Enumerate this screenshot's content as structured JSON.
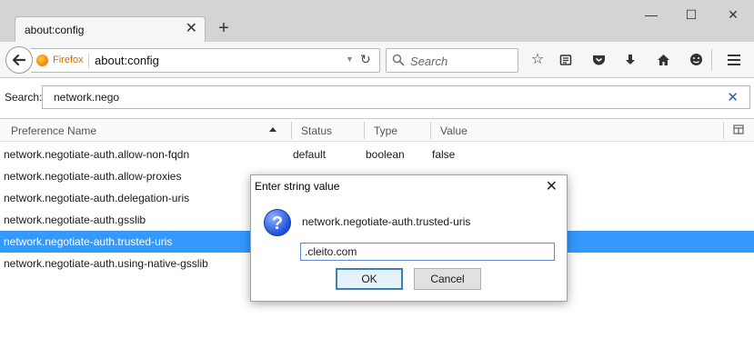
{
  "tab": {
    "title": "about:config",
    "close": "✕",
    "new_tab": "+"
  },
  "window": {
    "minimize": "—",
    "maximize": "☐",
    "close": "✕"
  },
  "navbar": {
    "identity_label": "Firefox",
    "url": "about:config",
    "search_placeholder": "Search"
  },
  "filter": {
    "label": "Search:",
    "value": "network.nego"
  },
  "columns": {
    "name": "Preference Name",
    "status": "Status",
    "type": "Type",
    "value": "Value"
  },
  "rows": [
    {
      "name": "network.negotiate-auth.allow-non-fqdn",
      "status": "default",
      "type": "boolean",
      "value": "false",
      "selected": false
    },
    {
      "name": "network.negotiate-auth.allow-proxies",
      "status": "",
      "type": "",
      "value": "",
      "selected": false
    },
    {
      "name": "network.negotiate-auth.delegation-uris",
      "status": "",
      "type": "",
      "value": "",
      "selected": false
    },
    {
      "name": "network.negotiate-auth.gsslib",
      "status": "",
      "type": "",
      "value": "",
      "selected": false
    },
    {
      "name": "network.negotiate-auth.trusted-uris",
      "status": "",
      "type": "",
      "value": "",
      "selected": true
    },
    {
      "name": "network.negotiate-auth.using-native-gsslib",
      "status": "",
      "type": "",
      "value": "",
      "selected": false
    }
  ],
  "dialog": {
    "title": "Enter string value",
    "close": "✕",
    "message": "network.negotiate-auth.trusted-uris",
    "input_value": ".cleito.com",
    "ok_label": "OK",
    "cancel_label": "Cancel"
  },
  "colors": {
    "selection": "#3399ff",
    "accent": "#d46a00",
    "tab_strip": "#d4d4d4"
  }
}
